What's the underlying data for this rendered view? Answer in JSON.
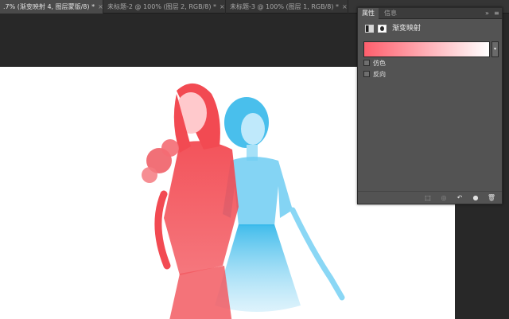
{
  "tabs": [
    {
      "label": ".7% (渐变映射 4, 图层蒙版/8) *",
      "close": "×",
      "active": true
    },
    {
      "label": "未标题-2 @ 100% (图层 2, RGB/8) *",
      "close": "×",
      "active": false
    },
    {
      "label": "未标题-3 @ 100% (图层 1, RGB/8) *",
      "close": "×",
      "active": false
    }
  ],
  "panel": {
    "tabs": [
      "属性",
      "信息"
    ],
    "collapse": "»",
    "menu": "≡",
    "title": "渐变映射",
    "gradient": {
      "from": "#ff5f6d",
      "to": "#ffffff"
    },
    "dropdown_icon": "chevron-down-icon",
    "dropdown_glyph": "▾",
    "checkboxes": [
      {
        "label": "仿色",
        "checked": false
      },
      {
        "label": "反向",
        "checked": false
      }
    ],
    "footer_icons": [
      {
        "name": "clip-to-layer-icon",
        "glyph": "⬚"
      },
      {
        "name": "view-previous-icon",
        "glyph": "◎"
      },
      {
        "name": "reset-icon",
        "glyph": "↶"
      },
      {
        "name": "visibility-eye-icon",
        "glyph": "●"
      },
      {
        "name": "trash-icon",
        "glyph": "🗑"
      }
    ]
  },
  "colors": {
    "red_tint": "#f24a52",
    "cyan_tint": "#35b8ea",
    "canvas": "#ffffff",
    "pasteboard": "#282828"
  }
}
